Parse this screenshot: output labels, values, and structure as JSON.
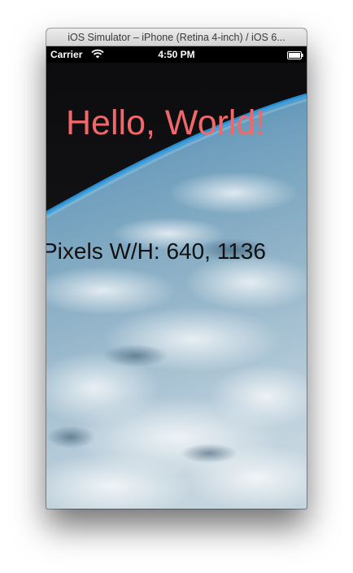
{
  "window": {
    "title": "iOS Simulator – iPhone (Retina 4-inch) / iOS 6..."
  },
  "status_bar": {
    "carrier": "Carrier",
    "time": "4:50 PM",
    "wifi_icon": "wifi-icon",
    "battery_icon": "battery-icon"
  },
  "app": {
    "greeting": "Hello, World!",
    "greeting_color": "#f2686a",
    "pixels_label": "Pixels W/H: 640, 1136",
    "background_image": "earth-from-space"
  }
}
